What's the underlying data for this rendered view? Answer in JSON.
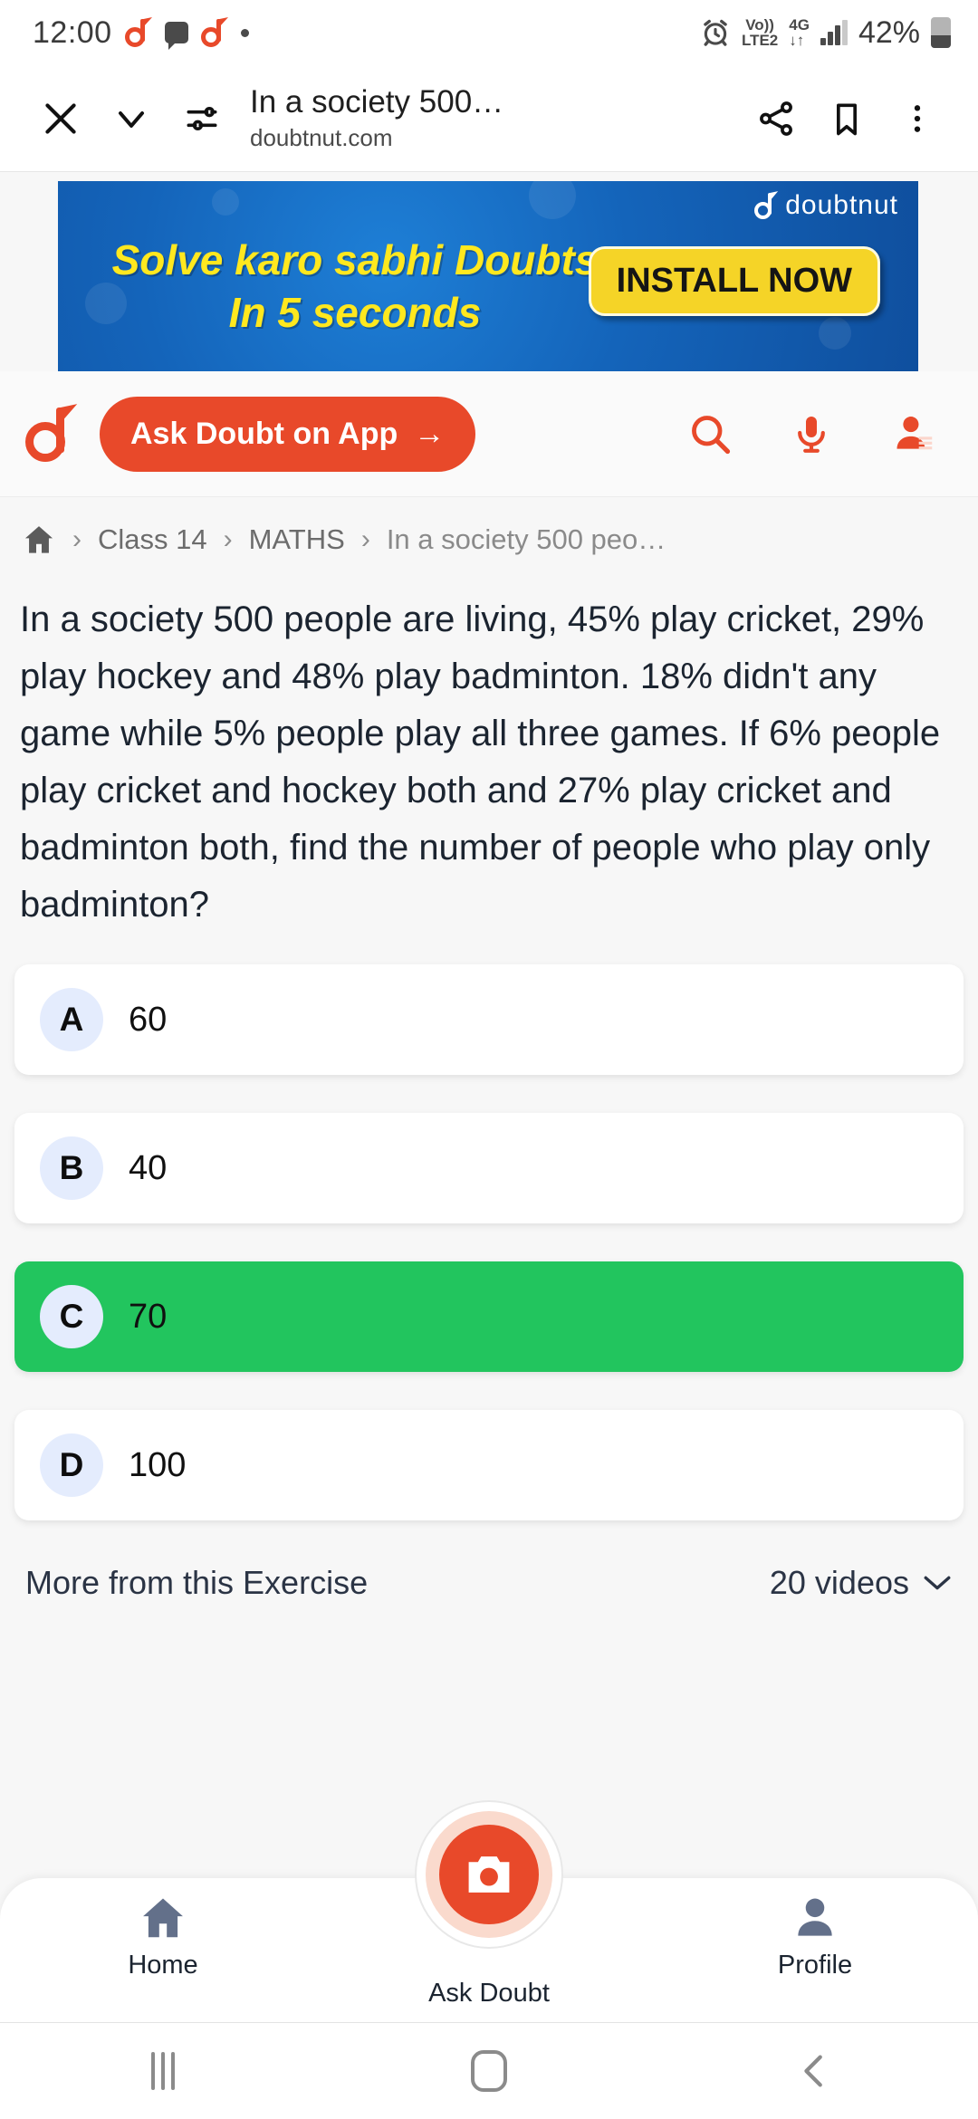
{
  "status_bar": {
    "time": "12:00",
    "icons_left": [
      "doubtnut-notification-icon",
      "message-icon",
      "doubtnut-notification-icon",
      "more-notifications-dot"
    ],
    "alarm_icon": "alarm-icon",
    "volte_line1": "Vo))",
    "volte_line2": "LTE2",
    "network_type": "4G",
    "data_arrows": "↓↑",
    "battery_percent": "42%"
  },
  "browser_bar": {
    "close_label": "✕",
    "chevron_label": "∨",
    "page_title": "In a society 500…",
    "page_url": "doubtnut.com",
    "icons": [
      "close-icon",
      "chevron-down-icon",
      "tune-icon",
      "share-icon",
      "bookmark-icon",
      "overflow-menu-icon"
    ]
  },
  "banner": {
    "headline_line1": "Solve karo sabhi Doubts",
    "headline_line2": "In 5 seconds",
    "cta_label": "INSTALL NOW",
    "brand": "doubtnut",
    "bg_color": "#1464ba",
    "cta_color": "#f5d427",
    "headline_color": "#ffe81f"
  },
  "site_header": {
    "logo_name": "doubtnut-logo",
    "ask_button_label": "Ask Doubt on App",
    "ask_button_arrow": "→",
    "brand_color": "#e8492a",
    "icons": [
      "search-icon",
      "microphone-icon",
      "profile-icon"
    ]
  },
  "breadcrumb": {
    "home_icon": "home-icon",
    "separator": "›",
    "items": [
      "Class 14",
      "MATHS",
      "In a society 500 peo…"
    ]
  },
  "question": {
    "text": "In a society 500 people are living, 45% play cricket, 29% play hockey and 48% play badminton. 18% didn't any game while 5% people play all three games. If 6% people play cricket and hockey both and 27% play cricket and badminton both, find the number of people who play only badminton?"
  },
  "options": [
    {
      "badge": "A",
      "text": "60",
      "correct": false
    },
    {
      "badge": "B",
      "text": "40",
      "correct": false
    },
    {
      "badge": "C",
      "text": "70",
      "correct": true
    },
    {
      "badge": "D",
      "text": "100",
      "correct": false
    }
  ],
  "correct_color": "#22c55e",
  "more_section": {
    "title": "More from this Exercise",
    "count_label": "20 videos",
    "chevron": "∨"
  },
  "bottom_nav": {
    "home_label": "Home",
    "ask_label": "Ask Doubt",
    "profile_label": "Profile"
  },
  "android_nav": {
    "recents": "recents-icon",
    "home": "home-pill-icon",
    "back": "‹"
  }
}
